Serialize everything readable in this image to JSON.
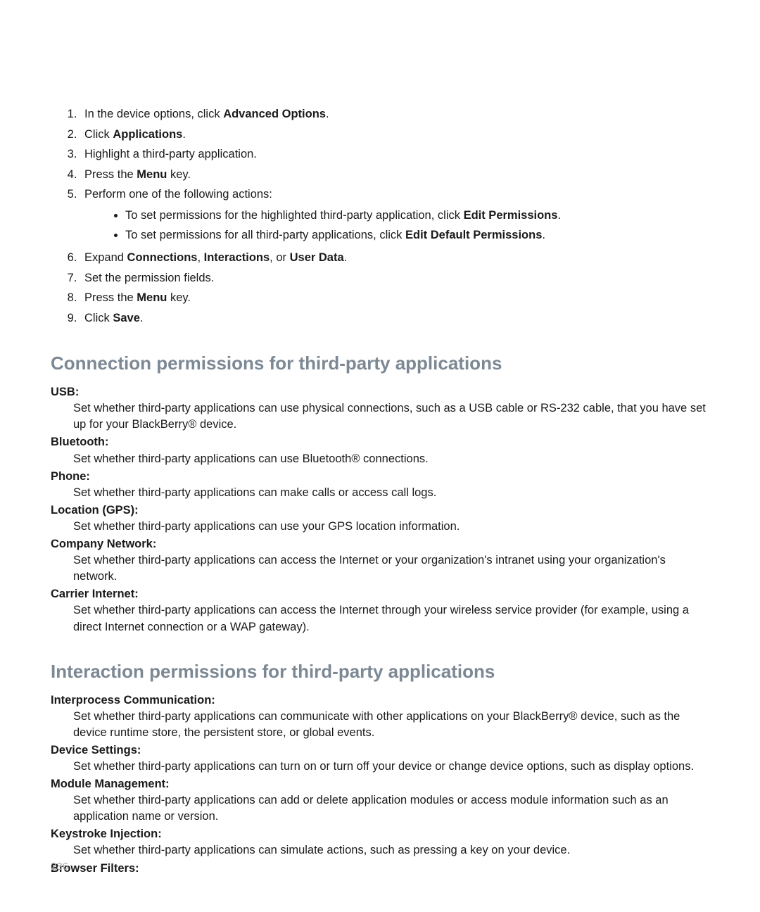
{
  "steps": {
    "s1_a": "In the device options, click ",
    "s1_b": "Advanced Options",
    "s2_a": "Click ",
    "s2_b": "Applications",
    "s3": "Highlight a third-party application.",
    "s4_a": "Press the ",
    "s4_b": "Menu",
    "s4_c": " key.",
    "s5": "Perform one of the following actions:",
    "s5_1a": "To set permissions for the highlighted third-party application, click ",
    "s5_1b": "Edit Permissions",
    "s5_2a": "To set permissions for all third-party applications, click ",
    "s5_2b": "Edit Default Permissions",
    "s6_a": "Expand ",
    "s6_b": "Connections",
    "s6_c": ", ",
    "s6_d": "Interactions",
    "s6_e": ", or ",
    "s6_f": "User Data",
    "s7": "Set the permission fields.",
    "s8_a": "Press the ",
    "s8_b": "Menu",
    "s8_c": " key.",
    "s9_a": "Click ",
    "s9_b": "Save"
  },
  "section1": {
    "title": "Connection permissions for third-party applications",
    "usb_t": "USB:",
    "usb_d": "Set whether third-party applications can use physical connections, such as a USB cable or RS-232 cable, that you have set up for your BlackBerry® device.",
    "bt_t": "Bluetooth:",
    "bt_d": "Set whether third-party applications can use Bluetooth® connections.",
    "ph_t": "Phone:",
    "ph_d": "Set whether third-party applications can make calls or access call logs.",
    "loc_t": "Location (GPS):",
    "loc_d": "Set whether third-party applications can use your GPS location information.",
    "cn_t": "Company Network:",
    "cn_d": "Set whether third-party applications can access the Internet or your organization's intranet using your organization's network.",
    "ci_t": "Carrier Internet:",
    "ci_d": "Set whether third-party applications can access the Internet through your wireless service provider (for example, using a direct Internet connection or a WAP gateway)."
  },
  "section2": {
    "title": "Interaction permissions for third-party applications",
    "ipc_t": "Interprocess Communication:",
    "ipc_d": "Set whether third-party applications can communicate with other applications on your BlackBerry® device, such as the device runtime store, the persistent store, or global events.",
    "ds_t": "Device Settings:",
    "ds_d": "Set whether third-party applications can turn on or turn off your device or change device options, such as display options.",
    "mm_t": "Module Management:",
    "mm_d": "Set whether third-party applications can add or delete application modules or access module information such as an application name or version.",
    "ki_t": "Keystroke Injection:",
    "ki_d": "Set whether third-party applications can simulate actions, such as pressing a key on your device.",
    "bf_t": "Browser Filters:"
  },
  "page_number": "236"
}
